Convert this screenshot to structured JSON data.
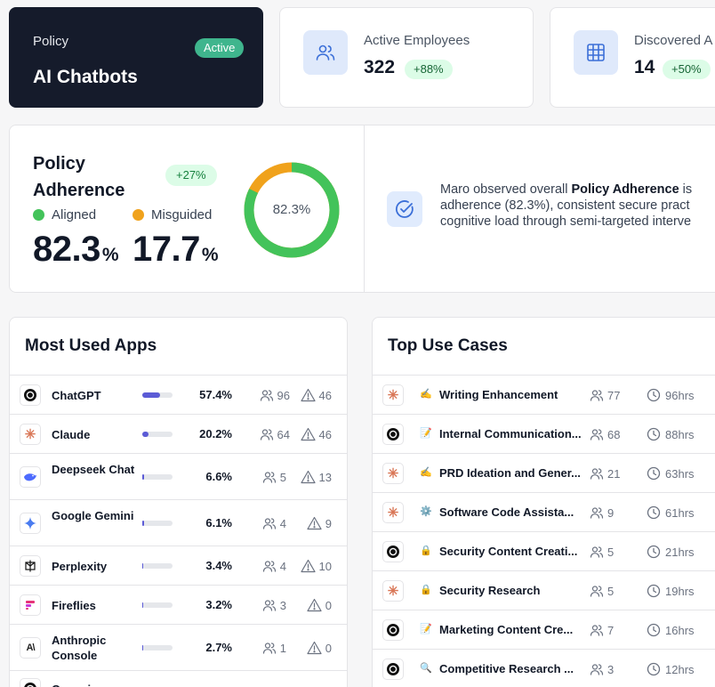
{
  "policy": {
    "kicker": "Policy",
    "status": "Active",
    "name": "AI Chatbots"
  },
  "stats": [
    {
      "label": "Active Employees",
      "value": "322",
      "badge": "+88%",
      "icon": "users-icon"
    },
    {
      "label": "Discovered A",
      "value": "14",
      "badge": "+50%",
      "icon": "grid-icon"
    }
  ],
  "adherence": {
    "title": "Policy Adherence",
    "delta": "+27%",
    "aligned_label": "Aligned",
    "misguided_label": "Misguided",
    "aligned_value": "82.3",
    "misguided_value": "17.7",
    "unit": "%",
    "donut_label": "82.3%",
    "aligned_fraction": 0.823,
    "colors": {
      "aligned": "#43c35a",
      "misguided": "#f0a21c"
    },
    "insight": {
      "line1_pre": "Maro observed overall ",
      "line1_bold": "Policy Adherence",
      "line1_post": " is",
      "line2": "adherence (82.3%), consistent secure pract",
      "line3": "cognitive load through semi-targeted interve"
    }
  },
  "apps": {
    "title": "Most Used Apps",
    "rows": [
      {
        "name": "ChatGPT",
        "pct": "57.4%",
        "fraction": 0.574,
        "users": "96",
        "alerts": "46",
        "logo": "openai-icon"
      },
      {
        "name": "Claude",
        "pct": "20.2%",
        "fraction": 0.202,
        "users": "64",
        "alerts": "46",
        "logo": "claude-icon"
      },
      {
        "name": "Deepseek Chat",
        "pct": "6.6%",
        "fraction": 0.066,
        "users": "5",
        "alerts": "13",
        "logo": "deepseek-icon"
      },
      {
        "name": "Google Gemini",
        "pct": "6.1%",
        "fraction": 0.061,
        "users": "4",
        "alerts": "9",
        "logo": "gemini-icon"
      },
      {
        "name": "Perplexity",
        "pct": "3.4%",
        "fraction": 0.034,
        "users": "4",
        "alerts": "10",
        "logo": "perplexity-icon"
      },
      {
        "name": "Fireflies",
        "pct": "3.2%",
        "fraction": 0.032,
        "users": "3",
        "alerts": "0",
        "logo": "fireflies-icon"
      },
      {
        "name": "Anthropic Console",
        "pct": "2.7%",
        "fraction": 0.027,
        "users": "1",
        "alerts": "0",
        "logo": "anthropic-icon"
      },
      {
        "name": "Openai",
        "pct": "",
        "fraction": 0,
        "users": "",
        "alerts": "",
        "logo": "openai-icon"
      }
    ]
  },
  "use_cases": {
    "title": "Top Use Cases",
    "rows": [
      {
        "emoji": "✍️",
        "name": "Writing Enhancement",
        "users": "77",
        "time": "96hrs",
        "logo": "claude-icon"
      },
      {
        "emoji": "📝",
        "name": "Internal Communication...",
        "users": "68",
        "time": "88hrs",
        "logo": "openai-icon"
      },
      {
        "emoji": "✍️",
        "name": "PRD Ideation and Gener...",
        "users": "21",
        "time": "63hrs",
        "logo": "claude-icon"
      },
      {
        "emoji": "⚙️",
        "name": "Software Code Assista...",
        "users": "9",
        "time": "61hrs",
        "logo": "claude-icon"
      },
      {
        "emoji": "🔒",
        "name": "Security Content Creati...",
        "users": "5",
        "time": "21hrs",
        "logo": "openai-icon"
      },
      {
        "emoji": "🔒",
        "name": "Security Research",
        "users": "5",
        "time": "19hrs",
        "logo": "claude-icon"
      },
      {
        "emoji": "📝",
        "name": "Marketing Content Cre...",
        "users": "7",
        "time": "16hrs",
        "logo": "openai-icon"
      },
      {
        "emoji": "🔍",
        "name": "Competitive Research ...",
        "users": "3",
        "time": "12hrs",
        "logo": "openai-icon"
      }
    ]
  }
}
